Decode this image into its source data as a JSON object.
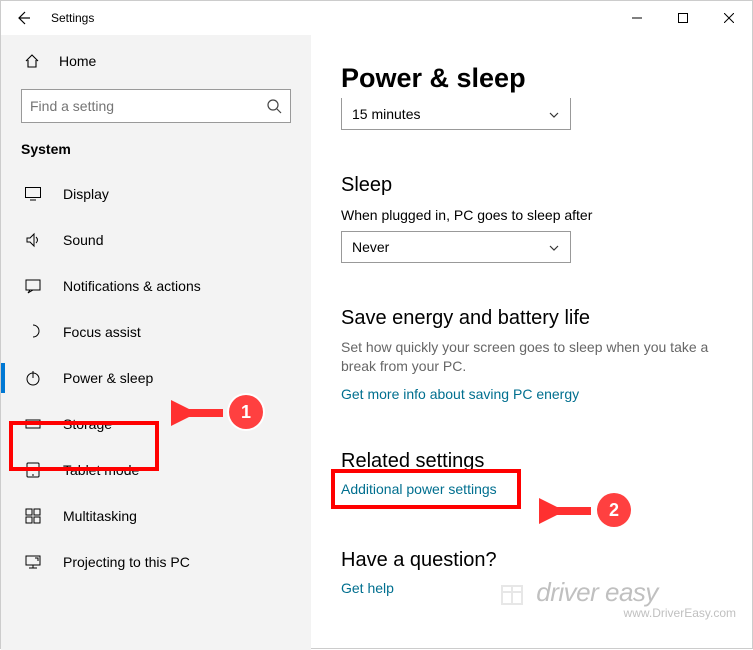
{
  "window": {
    "title": "Settings"
  },
  "sidebar": {
    "home": "Home",
    "search_placeholder": "Find a setting",
    "section": "System",
    "items": [
      {
        "label": "Display"
      },
      {
        "label": "Sound"
      },
      {
        "label": "Notifications & actions"
      },
      {
        "label": "Focus assist"
      },
      {
        "label": "Power & sleep"
      },
      {
        "label": "Storage"
      },
      {
        "label": "Tablet mode"
      },
      {
        "label": "Multitasking"
      },
      {
        "label": "Projecting to this PC"
      }
    ]
  },
  "main": {
    "title": "Power & sleep",
    "screen_dropdown": "15 minutes",
    "sleep_header": "Sleep",
    "sleep_label": "When plugged in, PC goes to sleep after",
    "sleep_dropdown": "Never",
    "energy_header": "Save energy and battery life",
    "energy_desc": "Set how quickly your screen goes to sleep when you take a break from your PC.",
    "energy_link": "Get more info about saving PC energy",
    "related_header": "Related settings",
    "related_link": "Additional power settings",
    "question_header": "Have a question?",
    "question_link": "Get help"
  },
  "annotations": {
    "marker1": "1",
    "marker2": "2"
  },
  "watermark": {
    "brand": "driver easy",
    "url": "www.DriverEasy.com"
  }
}
